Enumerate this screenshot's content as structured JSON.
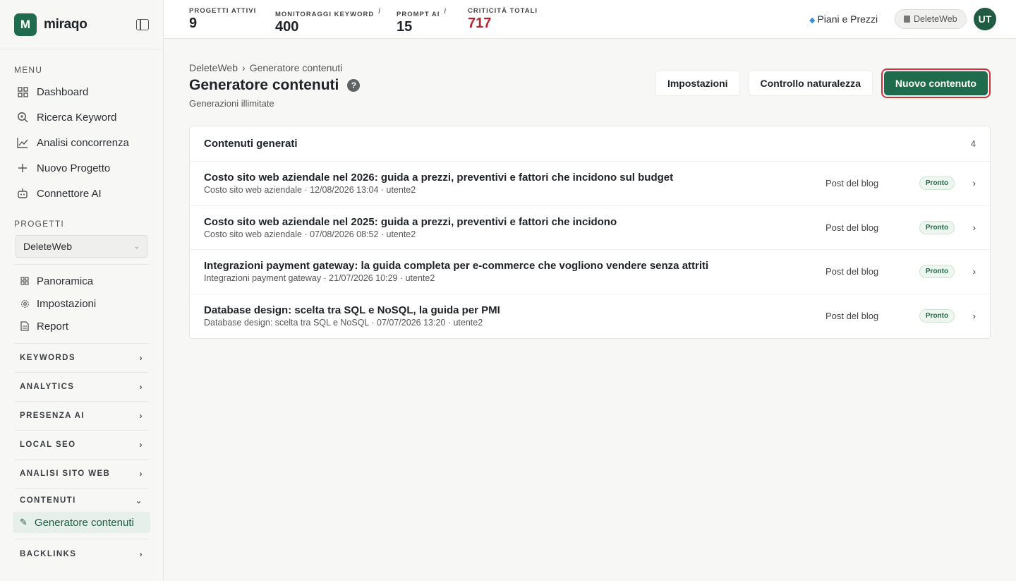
{
  "brand": {
    "logo_letter": "M",
    "name": "miraqo"
  },
  "sidebar": {
    "menu_title": "MENU",
    "menu_items": [
      {
        "label": "Dashboard",
        "icon": "grid-icon"
      },
      {
        "label": "Ricerca Keyword",
        "icon": "search-icon"
      },
      {
        "label": "Analisi concorrenza",
        "icon": "chart-icon"
      },
      {
        "label": "Nuovo Progetto",
        "icon": "plus-icon"
      },
      {
        "label": "Connettore AI",
        "icon": "robot-icon"
      }
    ],
    "projects_title": "PROGETTI",
    "project_selected": "DeleteWeb",
    "project_items": [
      {
        "label": "Panoramica",
        "icon": "grid-icon"
      },
      {
        "label": "Impostazioni",
        "icon": "gear-icon"
      },
      {
        "label": "Report",
        "icon": "document-icon"
      }
    ],
    "groups": {
      "keywords": "KEYWORDS",
      "analytics": "ANALYTICS",
      "presenza_ai": "PRESENZA AI",
      "local_seo": "LOCAL SEO",
      "analisi_sito": "ANALISI SITO WEB",
      "contenuti": "CONTENUTI",
      "backlinks": "BACKLINKS"
    },
    "active_item": "Generatore contenuti"
  },
  "topbar": {
    "stats": [
      {
        "label": "PROGETTI ATTIVI",
        "value": "9",
        "info": ""
      },
      {
        "label": "MONITORAGGI KEYWORD",
        "value": "400",
        "info": "i"
      },
      {
        "label": "PROMPT AI",
        "value": "15",
        "info": "i"
      },
      {
        "label": "CRITICITÀ TOTALI",
        "value": "717",
        "info": ""
      }
    ],
    "pricing_label": "Piani e Prezzi",
    "workspace_label": "DeleteWeb",
    "avatar_initials": "UT"
  },
  "main": {
    "breadcrumb": [
      "DeleteWeb",
      "Generatore contenuti"
    ],
    "breadcrumb_sep": "›",
    "title": "Generatore contenuti",
    "help": "?",
    "subtitle": "Generazioni illimitate",
    "actions": {
      "settings": "Impostazioni",
      "naturalness": "Controllo naturalezza",
      "new_content": "Nuovo contenuto"
    },
    "card": {
      "title": "Contenuti generati",
      "count": "4",
      "rows": [
        {
          "title": "Costo sito web aziendale nel 2026: guida a prezzi, preventivi e fattori che incidono sul budget",
          "meta": "Costo sito web aziendale · 12/08/2026 13:04 · utente2",
          "type": "Post del blog",
          "status": "Pronto"
        },
        {
          "title": "Costo sito web aziendale nel 2025: guida a prezzi, preventivi e fattori che incidono",
          "meta": "Costo sito web aziendale · 07/08/2026 08:52 · utente2",
          "type": "Post del blog",
          "status": "Pronto"
        },
        {
          "title": "Integrazioni payment gateway: la guida completa per e-commerce che vogliono vendere senza attriti",
          "meta": "Integrazioni payment gateway · 21/07/2026 10:29 · utente2",
          "type": "Post del blog",
          "status": "Pronto"
        },
        {
          "title": "Database design: scelta tra SQL e NoSQL, la guida per PMI",
          "meta": "Database design: scelta tra SQL e NoSQL · 07/07/2026 13:20 · utente2",
          "type": "Post del blog",
          "status": "Pronto"
        }
      ]
    }
  },
  "colors": {
    "brand": "#1f6b4d",
    "critical": "#b3262d",
    "highlight": "#c9343b"
  }
}
